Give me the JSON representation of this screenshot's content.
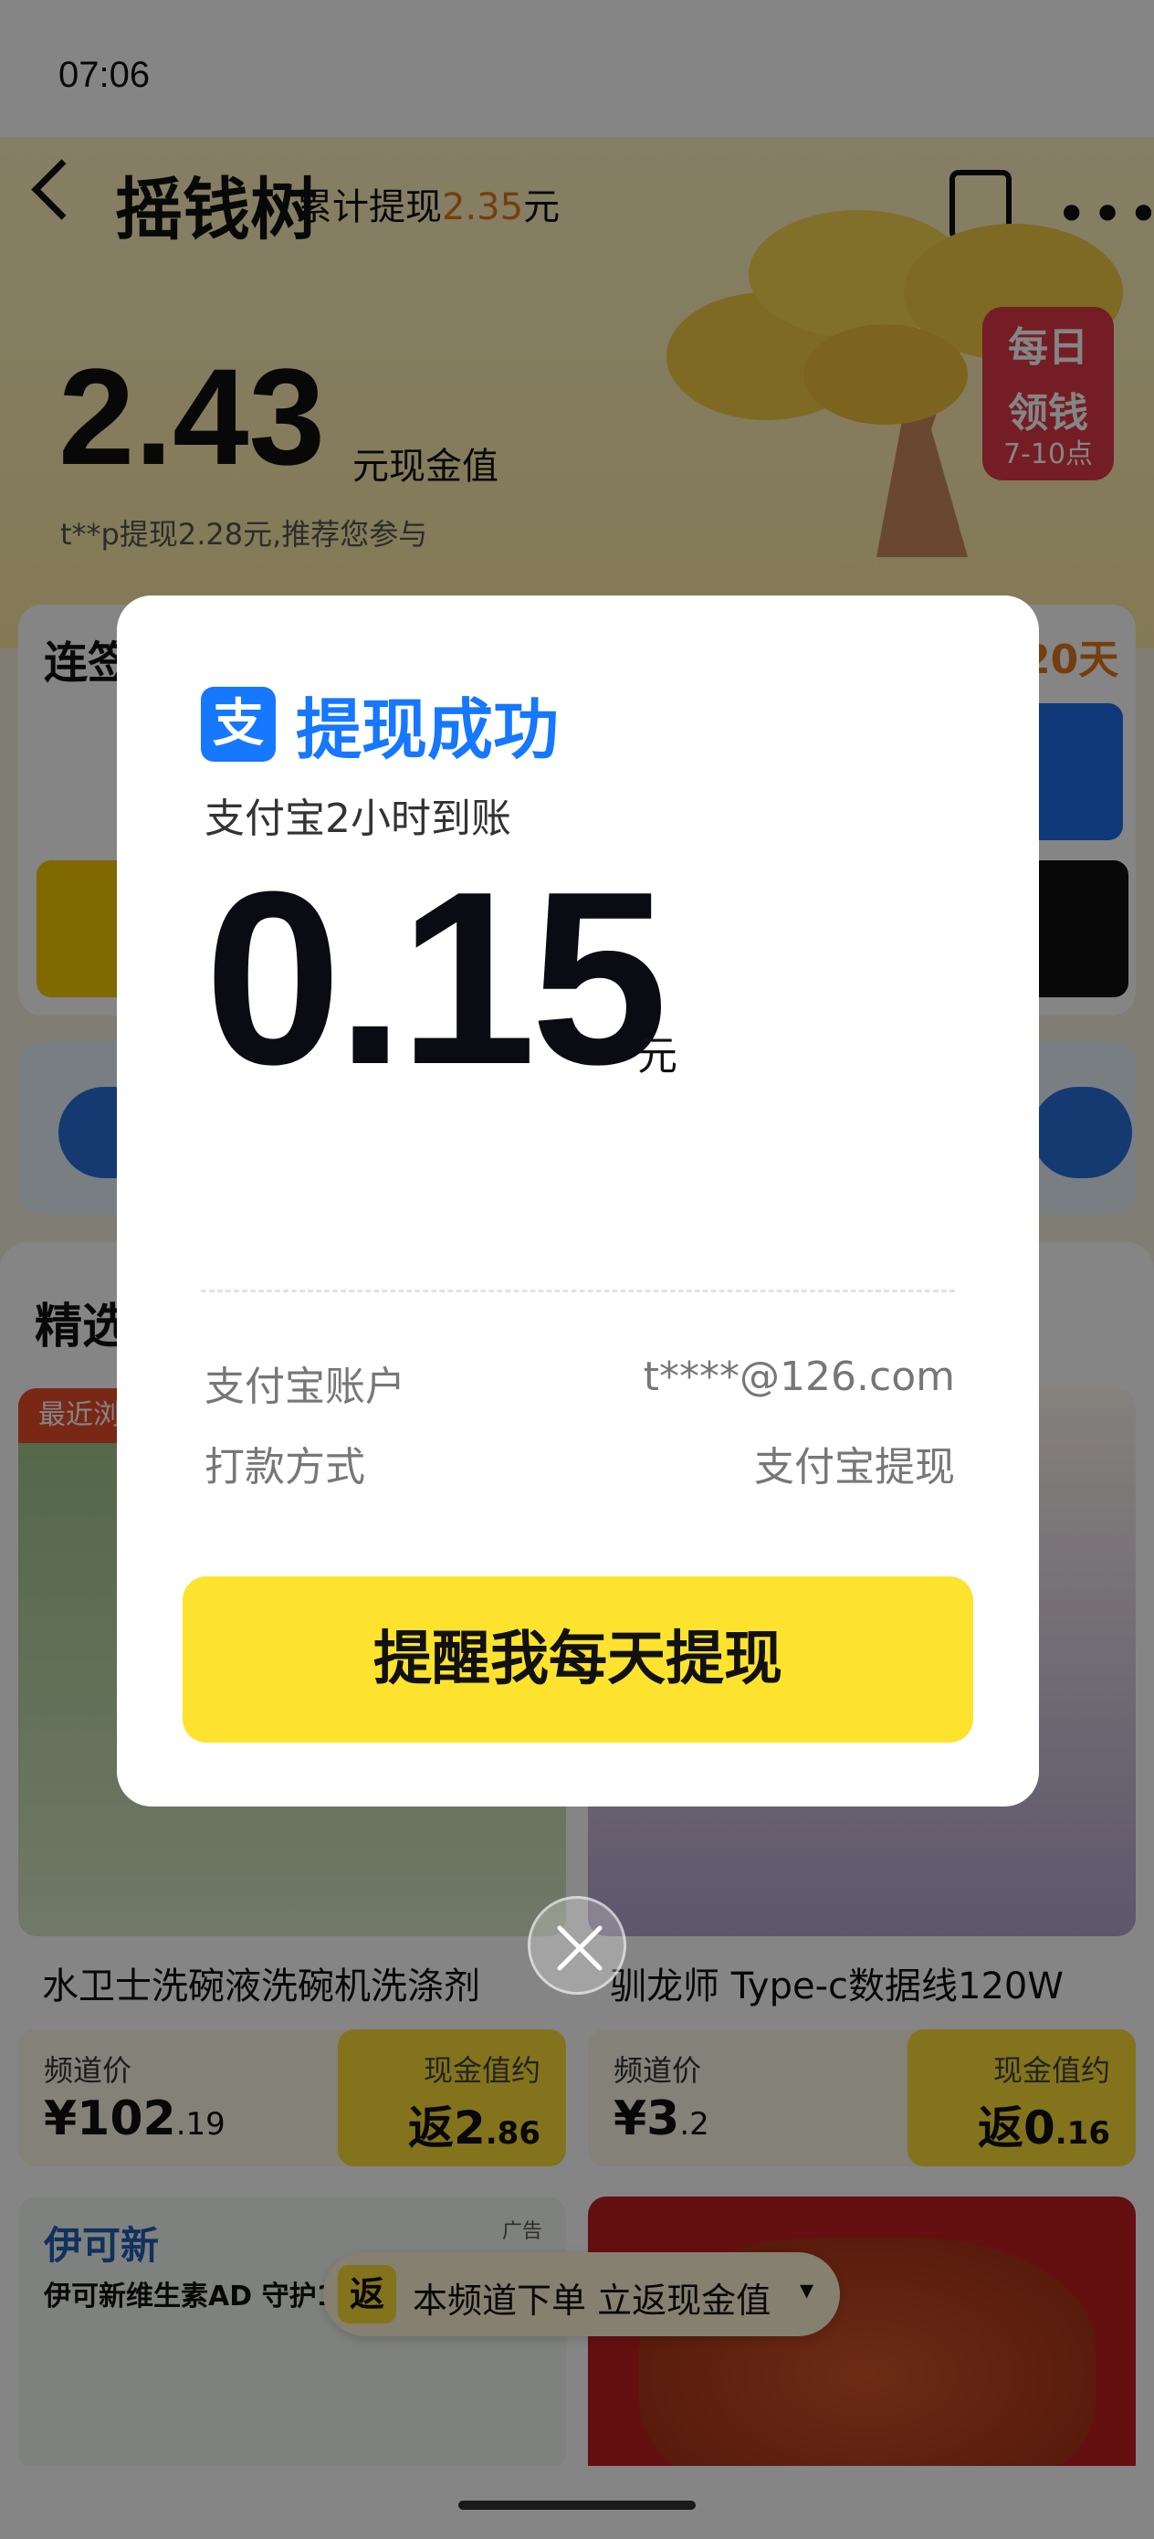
{
  "status": {
    "time": "07:06"
  },
  "header": {
    "title": "摇钱树",
    "cumulative_label": "累计提现",
    "cumulative_amount": "2.35",
    "cumulative_unit": "元"
  },
  "hero": {
    "value": "2.43",
    "value_unit": "元现金值",
    "note": "t**p提现2.28元,推荐您参与",
    "lantern_line1": "每日",
    "lantern_line2": "领钱",
    "lantern_line3": "7-10点"
  },
  "checkin_card": {
    "title": "连签",
    "days": "20天"
  },
  "feed": {
    "section_title": "精选",
    "recent_badge": "最近浏",
    "products": [
      {
        "name": "水卫士洗碗液洗碗机洗涤剂",
        "price_label": "频道价",
        "price_int": "¥102",
        "price_dec": ".19",
        "cash_label": "现金值约",
        "cash_int": "返2",
        "cash_dec": ".86"
      },
      {
        "name": "驯龙师 Type-c数据线120W",
        "price_label": "频道价",
        "price_int": "¥3",
        "price_dec": ".2",
        "cash_label": "现金值约",
        "cash_int": "返0",
        "cash_dec": ".16"
      }
    ],
    "ad": {
      "brand": "伊可新",
      "tagline": "伊可新维生素AD 守护1",
      "badge": "广告"
    }
  },
  "promo_bar": {
    "icon_text": "返",
    "text": "本频道下单 立返现金值"
  },
  "modal": {
    "icon_glyph": "支",
    "title": "提现成功",
    "subtitle": "支付宝2小时到账",
    "amount": "0.15",
    "unit": "元",
    "rows": [
      {
        "label": "支付宝账户",
        "value": "t****@126.com"
      },
      {
        "label": "打款方式",
        "value": "支付宝提现"
      }
    ],
    "button": "提醒我每天提现"
  },
  "colors": {
    "alipay_blue": "#1677ff",
    "button_yellow": "#fde32e",
    "accent_orange": "#e0781b"
  }
}
